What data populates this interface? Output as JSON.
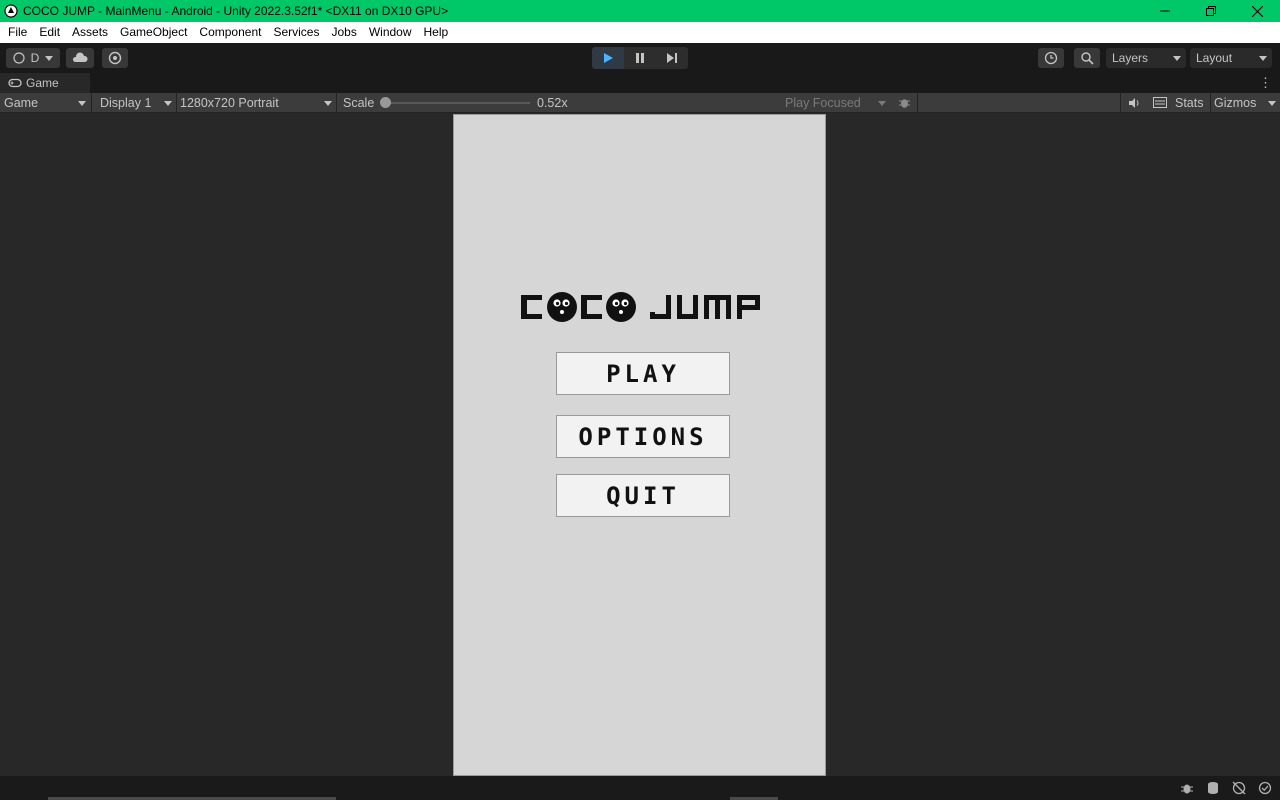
{
  "window": {
    "title": "COCO JUMP - MainMenu - Android - Unity 2022.3.52f1* <DX11 on DX10 GPU>",
    "titlebar_color": "#00c868"
  },
  "menu": [
    "File",
    "Edit",
    "Assets",
    "GameObject",
    "Component",
    "Services",
    "Jobs",
    "Window",
    "Help"
  ],
  "toolbar": {
    "account_label": "D",
    "layers_label": "Layers",
    "layout_label": "Layout"
  },
  "tab": {
    "label": "Game"
  },
  "gamebar": {
    "view_mode": "Game",
    "display": "Display 1",
    "resolution": "1280x720 Portrait",
    "scale_label": "Scale",
    "scale_value": "0.52x",
    "scale_fraction": 0.0,
    "play_mode": "Play Focused",
    "stats_label": "Stats",
    "gizmos_label": "Gizmos"
  },
  "game": {
    "logo_text": "COCO JUMP",
    "buttons": [
      "PLAY",
      "OPTIONS",
      "QUIT"
    ]
  }
}
